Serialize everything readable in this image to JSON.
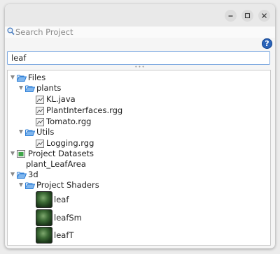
{
  "window": {
    "controls": [
      "minimize",
      "maximize",
      "close"
    ]
  },
  "search": {
    "label": "Search Project"
  },
  "help": {
    "glyph": "?"
  },
  "filter": {
    "value": "leaf"
  },
  "splitter": {
    "grip": "•••"
  },
  "tree": {
    "files": {
      "label": "Files",
      "plants": {
        "label": "plants",
        "items": [
          "KL.java",
          "PlantInterfaces.rgg",
          "Tomato.rgg"
        ]
      },
      "utils": {
        "label": "Utils",
        "items": [
          "Logging.rgg"
        ]
      }
    },
    "datasets": {
      "label": "Project Datasets",
      "items": [
        "plant_LeafArea"
      ]
    },
    "threed": {
      "label": "3d",
      "shaders": {
        "label": "Project Shaders",
        "items": [
          "leaf",
          "leafSm",
          "leafT"
        ]
      }
    }
  },
  "colors": {
    "folder": "#2f7fd6",
    "accent": "#7ba7df",
    "help": "#2a63b8"
  }
}
